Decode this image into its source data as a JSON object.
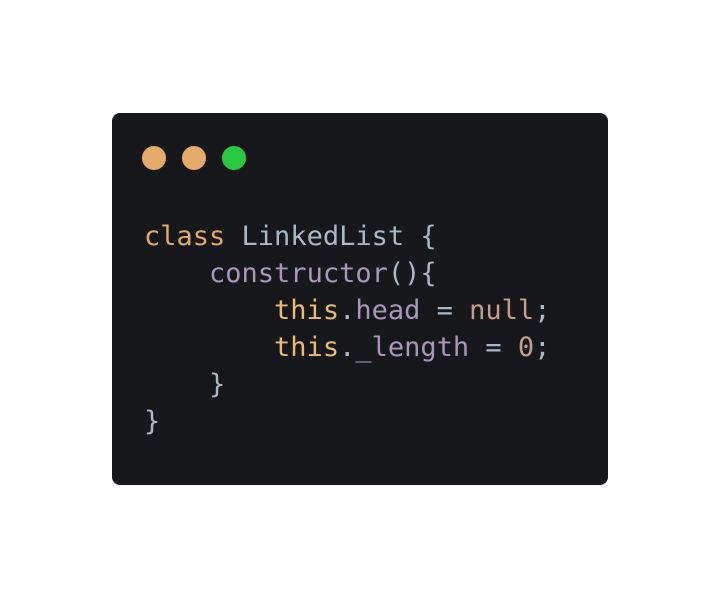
{
  "colors": {
    "background": "#ffffff",
    "window": "#17181b",
    "keyword": "#e3a868",
    "classname": "#a9b7c6",
    "method": "#a996b8",
    "this": "#e7bc70",
    "property": "#a996b8",
    "operator": "#a9b7c6",
    "literal": "#c69c8a",
    "punct": "#a9b7c6"
  },
  "window_dots": [
    {
      "name": "dot-orange-1",
      "color": "#e5a96a"
    },
    {
      "name": "dot-orange-2",
      "color": "#e5a96a"
    },
    {
      "name": "dot-green",
      "color": "#28c840"
    }
  ],
  "code_lines": [
    [
      {
        "text": "class",
        "kind": "keyword"
      },
      {
        "text": " ",
        "kind": "punct"
      },
      {
        "text": "LinkedList",
        "kind": "classname"
      },
      {
        "text": " {",
        "kind": "punct"
      }
    ],
    [
      {
        "text": "    ",
        "kind": "punct"
      },
      {
        "text": "constructor",
        "kind": "method"
      },
      {
        "text": "(){",
        "kind": "punct"
      }
    ],
    [
      {
        "text": "        ",
        "kind": "punct"
      },
      {
        "text": "this",
        "kind": "this"
      },
      {
        "text": ".",
        "kind": "punct"
      },
      {
        "text": "head",
        "kind": "property"
      },
      {
        "text": " = ",
        "kind": "operator"
      },
      {
        "text": "null",
        "kind": "literal"
      },
      {
        "text": ";",
        "kind": "punct"
      }
    ],
    [
      {
        "text": "        ",
        "kind": "punct"
      },
      {
        "text": "this",
        "kind": "this"
      },
      {
        "text": ".",
        "kind": "punct"
      },
      {
        "text": "_length",
        "kind": "property"
      },
      {
        "text": " = ",
        "kind": "operator"
      },
      {
        "text": "0",
        "kind": "literal"
      },
      {
        "text": ";",
        "kind": "punct"
      }
    ],
    [
      {
        "text": "    }",
        "kind": "punct"
      }
    ],
    [
      {
        "text": "}",
        "kind": "punct"
      }
    ]
  ]
}
